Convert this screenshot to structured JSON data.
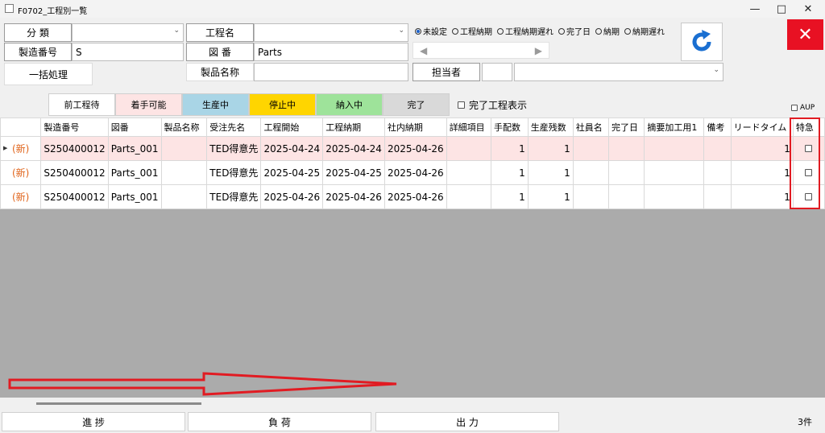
{
  "window": {
    "title": "F0702_工程別一覧"
  },
  "form": {
    "category_label": "分 類",
    "category_value": "",
    "process_name_label": "工程名",
    "process_name_value": "",
    "serial_label": "製造番号",
    "serial_value": "S",
    "drawing_label": "図 番",
    "drawing_value": "Parts",
    "product_name_label": "製品名称",
    "product_name_value": "",
    "bulk_button": "一括処理",
    "person_label": "担当者",
    "person_code": "",
    "person_name": ""
  },
  "filters": {
    "radios": [
      {
        "label": "未設定",
        "checked": true
      },
      {
        "label": "工程納期",
        "checked": false
      },
      {
        "label": "工程納期遅れ",
        "checked": false
      },
      {
        "label": "完了日",
        "checked": false
      },
      {
        "label": "納期",
        "checked": false
      },
      {
        "label": "納期遅れ",
        "checked": false
      }
    ],
    "nav_prev": "◀",
    "nav_next": "▶"
  },
  "status_tabs": [
    {
      "label": "前工程待",
      "color": "#ffffff"
    },
    {
      "label": "着手可能",
      "color": "#fde4e4"
    },
    {
      "label": "生産中",
      "color": "#a9d5e6"
    },
    {
      "label": "停止中",
      "color": "#ffd500"
    },
    {
      "label": "納入中",
      "color": "#9ee39a"
    },
    {
      "label": "完了",
      "color": "#d9d9d9"
    }
  ],
  "show_completed_label": "完了工程表示",
  "aup_label": "AUP",
  "grid": {
    "columns": [
      "製造番号",
      "図番",
      "製品名称",
      "受注先名",
      "工程開始",
      "工程納期",
      "社内納期",
      "詳細項目",
      "手配数",
      "生産残数",
      "社員名",
      "完了日",
      "摘要加工用1",
      "備考",
      "リードタイム",
      "特急"
    ],
    "rows": [
      {
        "marker": "(新)",
        "cells": [
          "S250400012",
          "Parts_001",
          "",
          "TED得意先",
          "2025-04-24",
          "2025-04-24",
          "2025-04-26",
          "",
          "1",
          "1",
          "",
          "",
          "",
          "",
          "1"
        ]
      },
      {
        "marker": "(新)",
        "cells": [
          "S250400012",
          "Parts_001",
          "",
          "TED得意先",
          "2025-04-25",
          "2025-04-25",
          "2025-04-26",
          "",
          "1",
          "1",
          "",
          "",
          "",
          "",
          "1"
        ]
      },
      {
        "marker": "(新)",
        "cells": [
          "S250400012",
          "Parts_001",
          "",
          "TED得意先",
          "2025-04-26",
          "2025-04-26",
          "2025-04-26",
          "",
          "1",
          "1",
          "",
          "",
          "",
          "",
          "1"
        ]
      }
    ]
  },
  "bottom": {
    "progress_button": "進 捗",
    "load_button": "負 荷",
    "output_button": "出 力",
    "count": "3件"
  },
  "colors": {
    "accent_blue": "#1a6fd1",
    "close_red": "#e81123",
    "annotation_red": "#e11b22"
  }
}
